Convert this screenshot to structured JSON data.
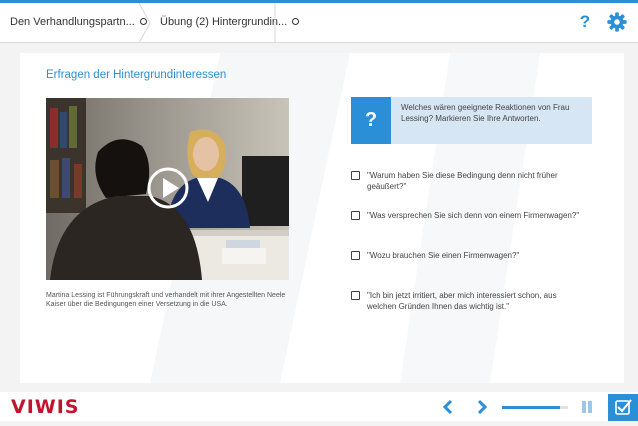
{
  "header": {
    "breadcrumbs": [
      {
        "label": "Den Verhandlungspartn..."
      },
      {
        "label": "Übung (2) Hintergrundin..."
      }
    ]
  },
  "content": {
    "title": "Erfragen der Hintergrundinteressen",
    "video_caption": "Martina Lessing ist Führungskraft und verhandelt mit ihrer Angestellten Neele Kaiser über die Bedingungen einer Versetzung in die USA.",
    "question": {
      "icon": "?",
      "text": "Welches wären geeignete Reaktionen von Frau Lessing? Markieren Sie Ihre Antworten."
    },
    "options": [
      {
        "text": "\"Warum haben Sie diese Bedingung denn nicht früher geäußert?\""
      },
      {
        "text": "\"Was versprechen Sie sich denn von einem Firmenwagen?\""
      },
      {
        "text": "\"Wozu brauchen Sie einen Firmenwagen?\""
      },
      {
        "text": "\"Ich bin jetzt irritiert, aber mich interessiert schon, aus welchen Gründen Ihnen das wichtig ist.\""
      }
    ]
  },
  "footer": {
    "logo": "VIWIS",
    "progress": 0.88
  },
  "colors": {
    "accent": "#2a8fd6",
    "brand": "#c0152d",
    "question_bg": "#d6e6f4"
  },
  "icons": {
    "help": "question-mark",
    "settings": "gear",
    "play": "play-circle",
    "prev": "chevron-left",
    "next": "chevron-right",
    "pause": "pause",
    "check": "check-square"
  }
}
